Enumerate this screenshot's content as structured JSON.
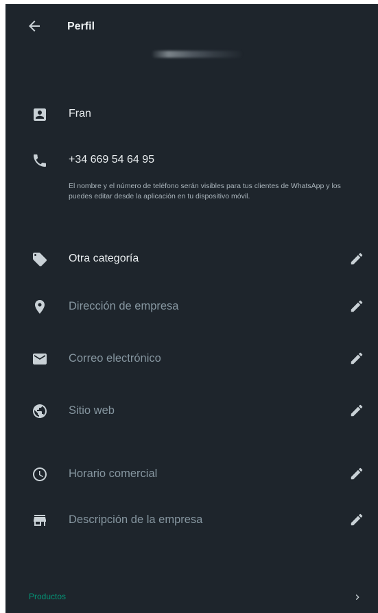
{
  "header": {
    "title": "Perfil"
  },
  "contact": {
    "name": "Fran",
    "phone": "+34 669 54 64 95",
    "note": "El nombre y el número de teléfono serán visibles para tus clientes de WhatsApp y los puedes editar desde la aplicación en tu dispositivo móvil."
  },
  "fields": [
    {
      "label": "Otra categoría",
      "icon": "tag-icon",
      "filled": true
    },
    {
      "label": "Dirección de empresa",
      "icon": "location-pin-icon",
      "filled": false
    },
    {
      "label": "Correo electrónico",
      "icon": "email-icon",
      "filled": false
    },
    {
      "label": "Sitio web",
      "icon": "globe-icon",
      "filled": false
    },
    {
      "label": "Horario comercial",
      "icon": "clock-icon",
      "filled": false
    },
    {
      "label": "Descripción de la empresa",
      "icon": "store-icon",
      "filled": false
    }
  ],
  "products": {
    "label": "Productos"
  },
  "colors": {
    "background": "#1e252c",
    "text_primary": "#e9edef",
    "text_secondary": "#8696a0",
    "icon": "#c9d1d6",
    "accent": "#00a884"
  }
}
